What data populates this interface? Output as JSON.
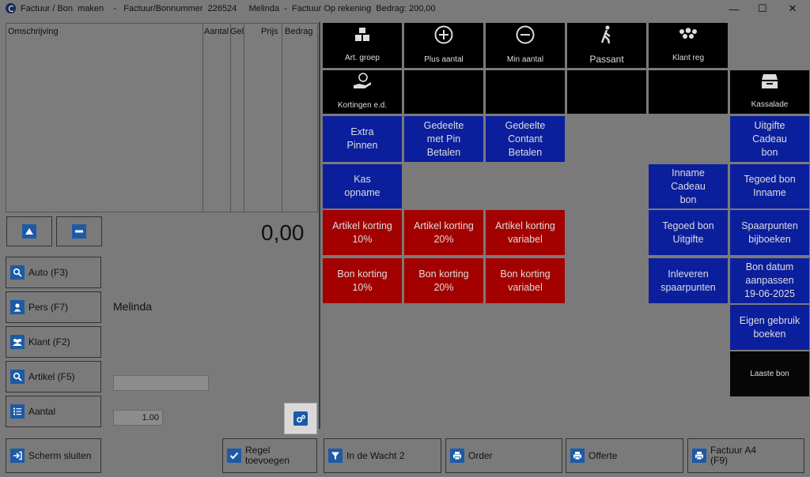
{
  "window": {
    "title": "Factuur / Bon  maken    -   Factuur/Bonnummer  226524     Melinda  -  Factuur Op rekening  Bedrag: 200,00",
    "minimize": "—",
    "maximize": "☐",
    "close": "✕"
  },
  "list": {
    "columns": [
      "Omschrijving",
      "Aantal",
      "Gel",
      "Prijs",
      "Bedrag"
    ]
  },
  "total": "0,00",
  "side": {
    "auto": "Auto (F3)",
    "pers": "Pers (F7)",
    "klant": "Klant (F2)",
    "artikel": "Artikel (F5)",
    "aantal": "Aantal",
    "customer_name": "Melinda",
    "artikel_value": "",
    "aantal_value": "1.00"
  },
  "tiles": {
    "art_groep": "Art. groep",
    "plus_aantal": "Plus aantal",
    "min_aantal": "Min aantal",
    "passant": "Passant",
    "klant_reg": "Klant reg",
    "kortingen": "Kortingen e.d.",
    "kassalade": "Kassalade",
    "extra_pinnen": "Extra\nPinnen",
    "gedeelte_pin": "Gedeelte\nmet Pin\nBetalen",
    "gedeelte_contant": "Gedeelte\nContant\nBetalen",
    "uitgifte_cadeau": "Uitgifte\nCadeau\nbon",
    "kas_opname": "Kas\nopname",
    "inname_cadeau": "Inname\nCadeau\nbon",
    "tegoed_inname": "Tegoed bon\nInname",
    "artikel_10": "Artikel korting\n10%",
    "artikel_20": "Artikel korting\n20%",
    "artikel_var": "Artikel korting\nvariabel",
    "tegoed_uitgifte": "Tegoed bon\nUitgifte",
    "spaarpunten_bij": "Spaarpunten\nbijboeken",
    "bon_10": "Bon korting\n10%",
    "bon_20": "Bon korting\n20%",
    "bon_var": "Bon korting\nvariabel",
    "inleveren": "Inleveren\nspaarpunten",
    "bon_datum": "Bon datum\naanpassen\n19-06-2025",
    "eigen_gebruik": "Eigen gebruik\nboeken",
    "laatste_bon": "Laaste bon"
  },
  "bottom": {
    "scherm_sluiten": "Scherm sluiten",
    "regel_toevoegen": "Regel\ntoevoegen",
    "in_de_wacht": "In de Wacht 2",
    "order": "Order",
    "offerte": "Offerte",
    "factuur_a4": "Factuur A4\n(F9)"
  }
}
